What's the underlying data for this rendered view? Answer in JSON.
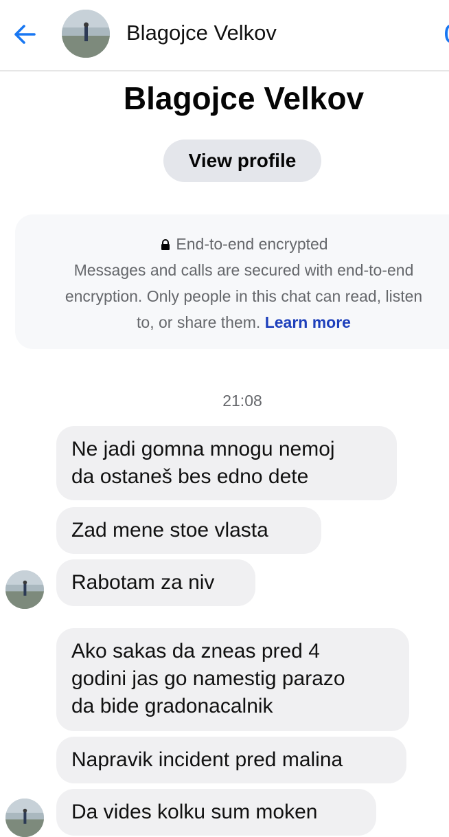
{
  "header": {
    "title": "Blagojce Velkov",
    "back_icon": "back-arrow-icon",
    "accent_color": "#1877f2"
  },
  "profile": {
    "name": "Blagojce Velkov",
    "view_profile_label": "View profile"
  },
  "encryption_notice": {
    "icon": "lock-icon",
    "title": "End-to-end encrypted",
    "line1": "Messages and calls are secured with end-to-end",
    "line2": "encryption. Only people in this chat can read, listen",
    "line3": "to, or share them.",
    "learn_more": "Learn more",
    "link_color": "#1d3fbb"
  },
  "timestamp": "21:08",
  "messages": [
    {
      "lines": [
        "Ne jadi gomna mnogu nemoj",
        "da ostaneš bes edno dete"
      ]
    },
    {
      "lines": [
        "Zad mene stoe vlasta"
      ]
    },
    {
      "lines": [
        "Rabotam za niv"
      ]
    },
    {
      "lines": [
        "Ako sakas da zneas pred 4",
        "godini jas go namestig parazo",
        "da bide gradonacalnik"
      ]
    },
    {
      "lines": [
        "Napravik incident pred malina"
      ]
    },
    {
      "lines": [
        "Da vides kolku sum moken"
      ]
    }
  ],
  "colors": {
    "bubble_bg": "#f0f0f2",
    "secondary_text": "#65676b"
  }
}
